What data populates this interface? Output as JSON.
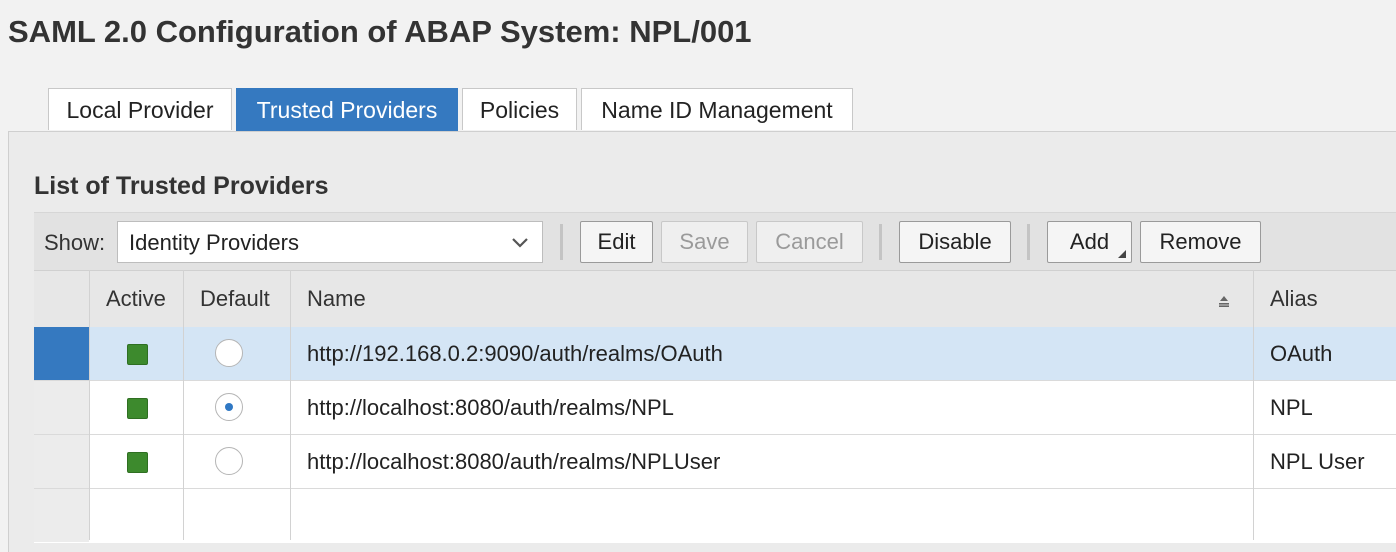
{
  "page": {
    "title": "SAML 2.0 Configuration of ABAP System: NPL/001"
  },
  "tabs": [
    {
      "label": "Local Provider",
      "selected": false
    },
    {
      "label": "Trusted Providers",
      "selected": true
    },
    {
      "label": "Policies",
      "selected": false
    },
    {
      "label": "Name ID Management",
      "selected": false
    }
  ],
  "section": {
    "title": "List of Trusted Providers"
  },
  "toolbar": {
    "show_label": "Show:",
    "show_value": "Identity Providers",
    "edit_label": "Edit",
    "save_label": "Save",
    "cancel_label": "Cancel",
    "disable_label": "Disable",
    "add_label": "Add",
    "remove_label": "Remove"
  },
  "table": {
    "headers": {
      "active": "Active",
      "default": "Default",
      "name": "Name",
      "alias": "Alias"
    },
    "rows": [
      {
        "active": true,
        "default": false,
        "name": "http://192.168.0.2:9090/auth/realms/OAuth",
        "alias": "OAuth",
        "selected": true
      },
      {
        "active": true,
        "default": true,
        "name": "http://localhost:8080/auth/realms/NPL",
        "alias": "NPL",
        "selected": false
      },
      {
        "active": true,
        "default": false,
        "name": "http://localhost:8080/auth/realms/NPLUser",
        "alias": "NPL User",
        "selected": false
      }
    ]
  },
  "colors": {
    "accent": "#3579c0",
    "active_status": "#3d8a2d",
    "selected_row": "#d4e5f5"
  }
}
